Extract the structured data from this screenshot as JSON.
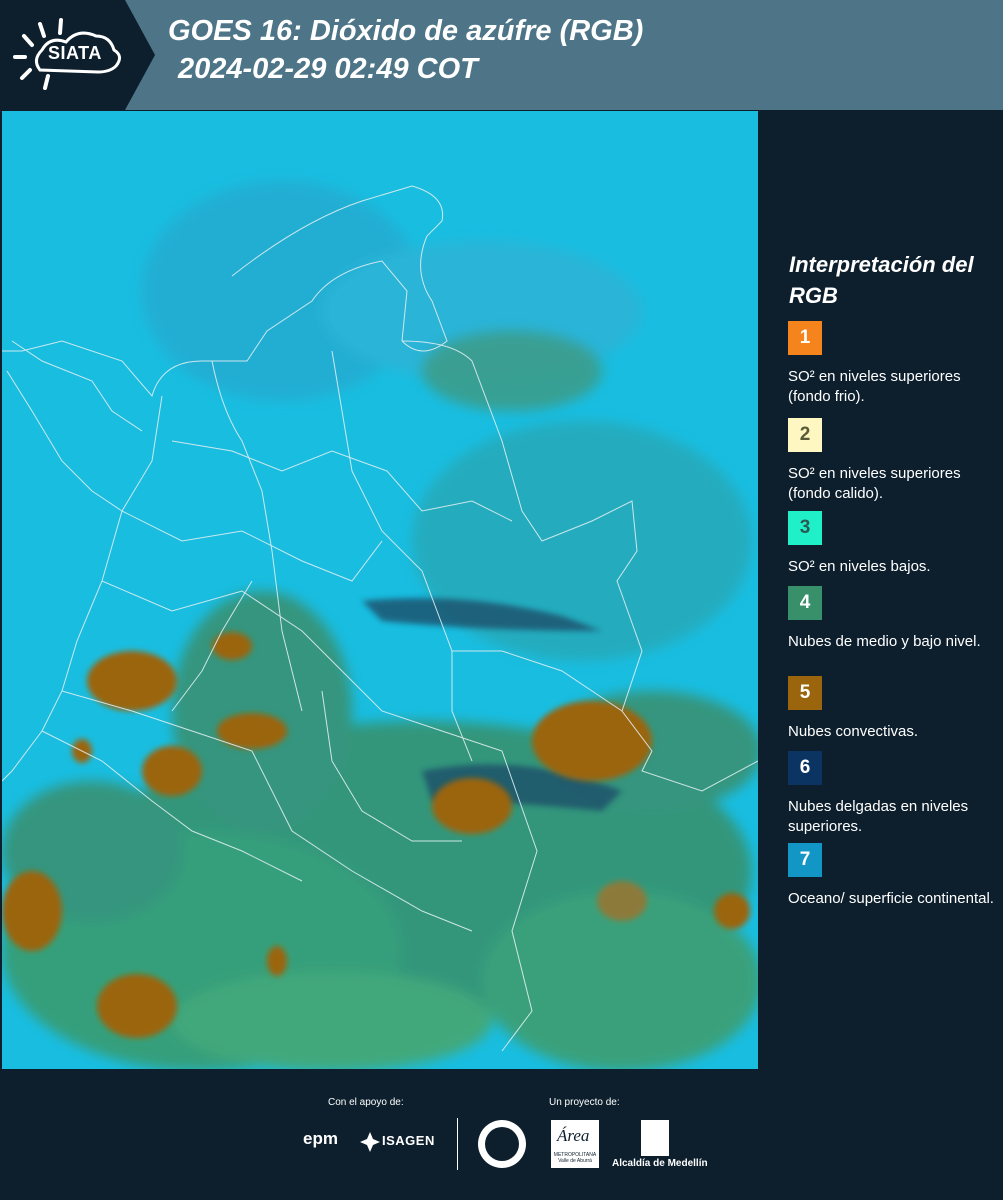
{
  "header": {
    "logo": "SIATA",
    "title_line1": "GOES 16: Dióxido de azúfre (RGB)",
    "title_line2": "2024-02-29 02:49 COT",
    "background_color": "#4d7587",
    "logo_block_color": "#0d1f2d"
  },
  "map": {
    "name": "satellite-map",
    "ocean_color": "#19bde0",
    "border_color": "#dfeef2"
  },
  "legend": {
    "title": "Interpretación del RGB",
    "items": [
      {
        "number": "1",
        "color": "#f6841d",
        "text": "SO² en niveles superiores (fondo frio)."
      },
      {
        "number": "2",
        "color": "#fff7c2",
        "text": "SO² en niveles superiores (fondo calido)."
      },
      {
        "number": "3",
        "color": "#1ff0c8",
        "text": "SO² en niveles bajos."
      },
      {
        "number": "4",
        "color": "#37906a",
        "text": "Nubes de medio y bajo nivel."
      },
      {
        "number": "5",
        "color": "#9b650d",
        "text": "Nubes convectivas."
      },
      {
        "number": "6",
        "color": "#0c3463",
        "text": "Nubes delgadas en niveles superiores."
      },
      {
        "number": "7",
        "color": "#1196c6",
        "text": "Oceano/ superficie continental."
      }
    ]
  },
  "footer": {
    "support_label": "Con el apoyo de:",
    "project_label": "Un proyecto de:",
    "epm": "epm",
    "isagen": "ISAGEN",
    "area_word": "Área",
    "area_sub": "METROPOLITANA Valle de Aburrá",
    "alcaldia": "Alcaldía de Medellín"
  }
}
